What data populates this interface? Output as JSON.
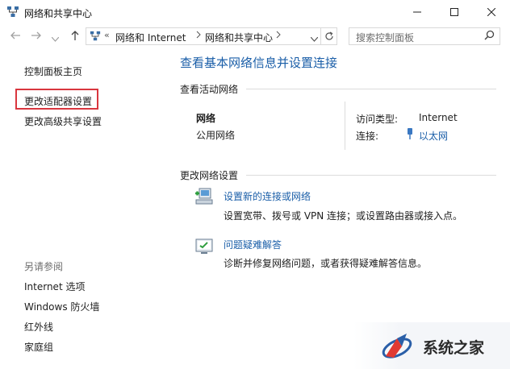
{
  "window": {
    "title": "网络和共享中心"
  },
  "nav": {
    "back_icon": "arrow-left-icon",
    "forward_icon": "arrow-right-icon",
    "recent_icon": "chevron-down-icon",
    "up_icon": "arrow-up-icon"
  },
  "address": {
    "overflow": "«",
    "crumbs": [
      "网络和 Internet",
      "网络和共享中心"
    ]
  },
  "search": {
    "placeholder": "搜索控制面板"
  },
  "sidebar": {
    "home": "控制面板主页",
    "links": [
      "更改适配器设置",
      "更改高级共享设置"
    ],
    "see_also_title": "另请参阅",
    "see_also": [
      "Internet 选项",
      "Windows 防火墙",
      "红外线",
      "家庭组"
    ]
  },
  "main": {
    "heading": "查看基本网络信息并设置连接",
    "active_title": "查看活动网络",
    "network": {
      "name": "网络",
      "category": "公用网络"
    },
    "access_type_label": "访问类型:",
    "access_type_value": "Internet",
    "connection_label": "连接:",
    "connection_value": "以太网",
    "change_title": "更改网络设置",
    "tasks": [
      {
        "title": "设置新的连接或网络",
        "desc": "设置宽带、拨号或 VPN 连接；或设置路由器或接入点。",
        "icon": "new-connection-icon"
      },
      {
        "title": "问题疑难解答",
        "desc": "诊断并修复网络问题，或者获得疑难解答信息。",
        "icon": "troubleshoot-icon"
      }
    ]
  },
  "watermark": {
    "text": "系统之家"
  },
  "colors": {
    "link": "#1a5ea8",
    "highlight_border": "#d9363e"
  }
}
